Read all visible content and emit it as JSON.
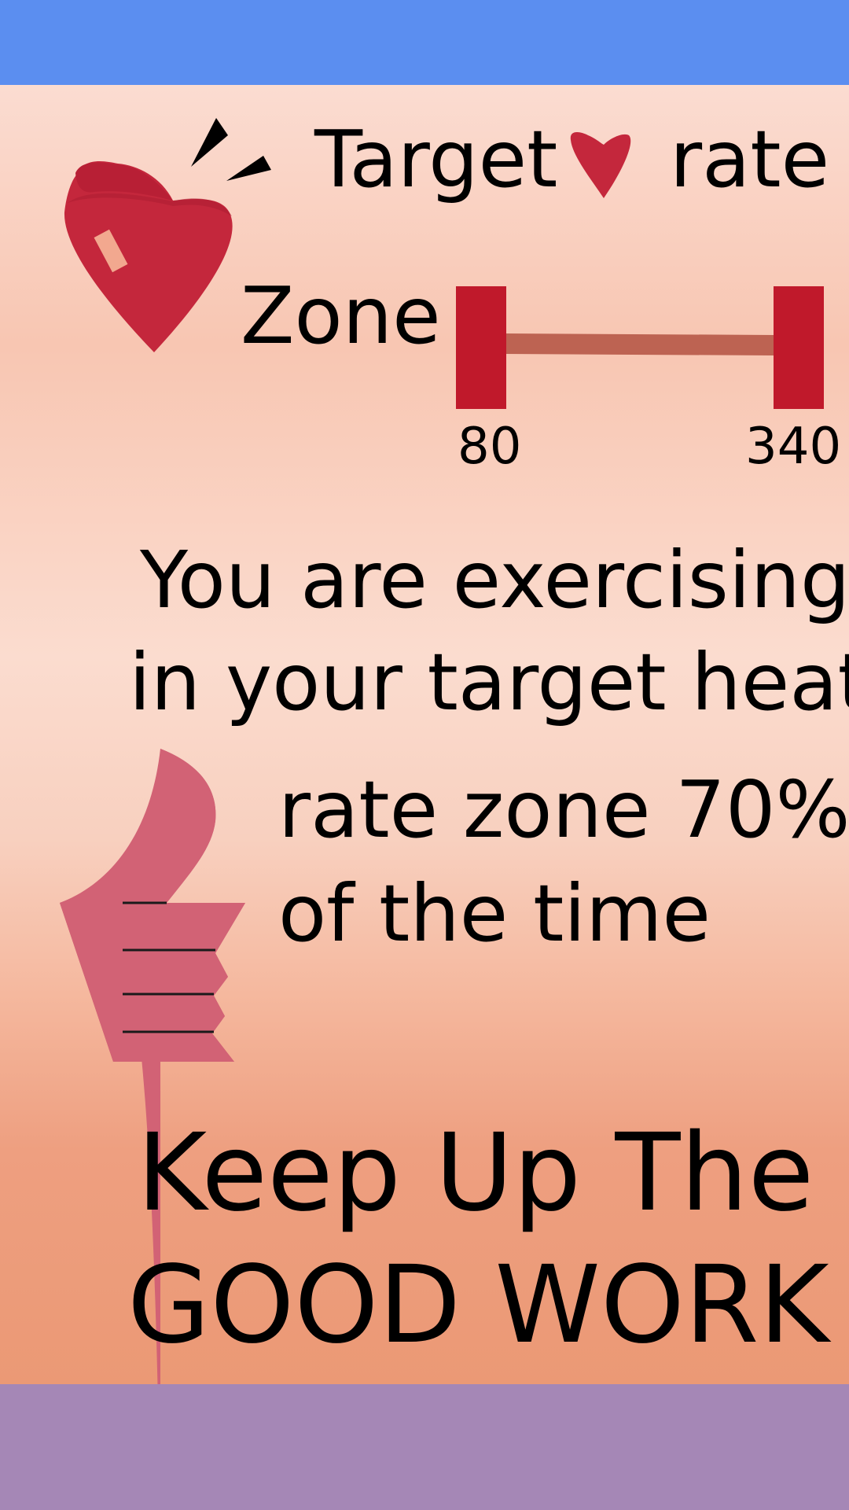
{
  "header": {
    "title_left": "Target",
    "title_right": "rate",
    "zone_label": "Zone"
  },
  "zone": {
    "min": "80",
    "max": "340"
  },
  "message": {
    "lines": [
      "You are exercising",
      "in your target heat",
      "rate zone 70%",
      "of the time"
    ]
  },
  "cheer": {
    "line1": "Keep Up The",
    "line2": "GOOD WORK"
  },
  "colors": {
    "top_bar": "#5b8ef0",
    "bottom_bar": "#a587b6",
    "heart": "#c4273c",
    "zone_marker": "#c0192b",
    "zone_track": "#bd6352",
    "thumb": "#d26275"
  },
  "icons": {
    "heart_with_bandage": "heart-bandage-icon",
    "small_heart": "heart-icon",
    "thumbs_up": "thumbs-up-icon"
  }
}
